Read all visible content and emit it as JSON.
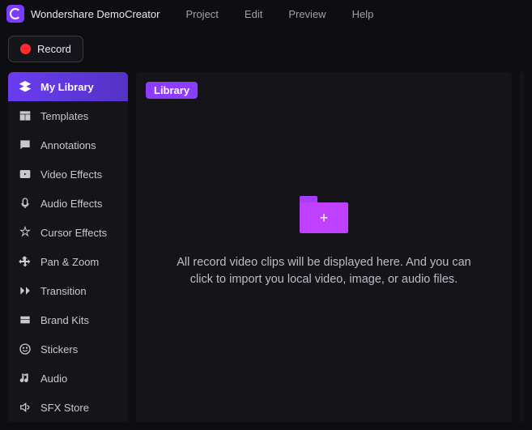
{
  "app": {
    "title": "Wondershare DemoCreator"
  },
  "menu": {
    "project": "Project",
    "edit": "Edit",
    "preview": "Preview",
    "help": "Help"
  },
  "toolbar": {
    "record_label": "Record"
  },
  "sidebar": {
    "items": [
      {
        "label": "My Library",
        "icon": "layers-icon"
      },
      {
        "label": "Templates",
        "icon": "templates-icon"
      },
      {
        "label": "Annotations",
        "icon": "annotations-icon"
      },
      {
        "label": "Video Effects",
        "icon": "video-effects-icon"
      },
      {
        "label": "Audio Effects",
        "icon": "audio-effects-icon"
      },
      {
        "label": "Cursor Effects",
        "icon": "cursor-effects-icon"
      },
      {
        "label": "Pan & Zoom",
        "icon": "pan-zoom-icon"
      },
      {
        "label": "Transition",
        "icon": "transition-icon"
      },
      {
        "label": "Brand Kits",
        "icon": "brand-kits-icon"
      },
      {
        "label": "Stickers",
        "icon": "stickers-icon"
      },
      {
        "label": "Audio",
        "icon": "audio-icon"
      },
      {
        "label": "SFX Store",
        "icon": "sfx-store-icon"
      }
    ]
  },
  "main": {
    "tab_label": "Library",
    "empty_text": "All record video clips will be displayed here. And you can click to import you local video, image, or audio files."
  }
}
